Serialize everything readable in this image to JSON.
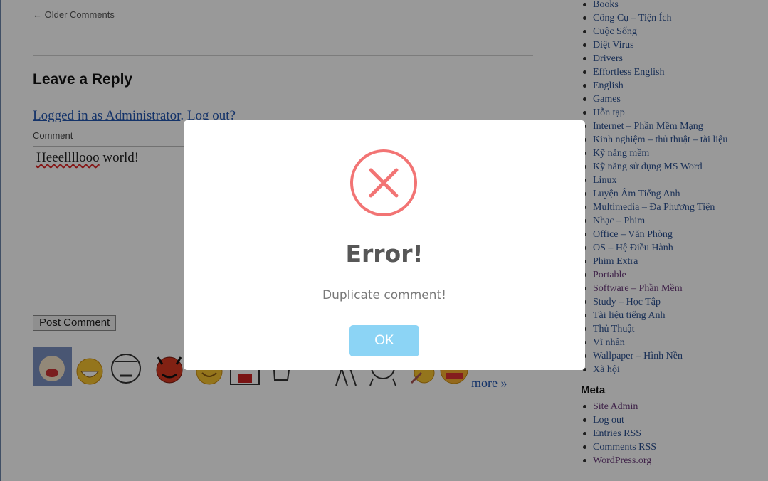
{
  "content": {
    "older_comments": "← Older Comments",
    "reply_title": "Leave a Reply",
    "logged_in_text": "Logged in as Administrator",
    "logout_text": "Log out?",
    "comment_label": "Comment",
    "comment_misspelled": "Heeellllooo",
    "comment_rest": " world!",
    "post_button": "Post Comment",
    "more_link": "more »"
  },
  "sidebar": {
    "categories": [
      {
        "label": "Books",
        "visited": false
      },
      {
        "label": "Công Cụ – Tiện Ích",
        "visited": false
      },
      {
        "label": "Cuộc Sống",
        "visited": false
      },
      {
        "label": "Diệt Virus",
        "visited": false
      },
      {
        "label": "Drivers",
        "visited": false
      },
      {
        "label": "Effortless English",
        "visited": false
      },
      {
        "label": "English",
        "visited": false
      },
      {
        "label": "Games",
        "visited": false
      },
      {
        "label": "Hỗn tạp",
        "visited": false
      },
      {
        "label": "Internet – Phần Mềm Mạng",
        "visited": false
      },
      {
        "label": "Kinh nghiệm – thủ thuật – tài liệu",
        "visited": false
      },
      {
        "label": "Kỹ năng mềm",
        "visited": false
      },
      {
        "label": "Kỹ năng sử dụng MS Word",
        "visited": false
      },
      {
        "label": "Linux",
        "visited": false
      },
      {
        "label": "Luyện Âm Tiếng Anh",
        "visited": false
      },
      {
        "label": "Multimedia – Đa Phương Tiện",
        "visited": false
      },
      {
        "label": "Nhạc – Phim",
        "visited": false
      },
      {
        "label": "Office – Văn Phòng",
        "visited": false
      },
      {
        "label": "OS – Hệ Điều Hành",
        "visited": false
      },
      {
        "label": "Phim Extra",
        "visited": false
      },
      {
        "label": "Portable",
        "visited": true
      },
      {
        "label": "Software – Phần Mềm",
        "visited": true
      },
      {
        "label": "Study – Học Tập",
        "visited": false
      },
      {
        "label": "Tài liệu tiếng Anh",
        "visited": false
      },
      {
        "label": "Thủ Thuật",
        "visited": false
      },
      {
        "label": "Vĩ nhân",
        "visited": false
      },
      {
        "label": "Wallpaper – Hình Nền",
        "visited": false
      },
      {
        "label": "Xã hội",
        "visited": false
      }
    ],
    "meta_title": "Meta",
    "meta_links": [
      {
        "label": "Site Admin",
        "visited": true
      },
      {
        "label": "Log out",
        "visited": false
      },
      {
        "label": "Entries RSS",
        "visited": false
      },
      {
        "label": "Comments RSS",
        "visited": false
      },
      {
        "label": "WordPress.org",
        "visited": true
      }
    ]
  },
  "modal": {
    "title": "Error!",
    "message": "Duplicate comment!",
    "ok_label": "OK",
    "icon": "error-x-icon",
    "icon_color": "#f27474",
    "button_color": "#8cd4f5"
  },
  "smileys": [
    "avatar-face",
    "laughing-smiley",
    "crying-face",
    "devil-smiley",
    "happy-smiley",
    "shouting-face",
    "sketch-face",
    "dancing-figure",
    "sketch-face-2",
    "rocket-smiley",
    "nervous-smiley"
  ]
}
